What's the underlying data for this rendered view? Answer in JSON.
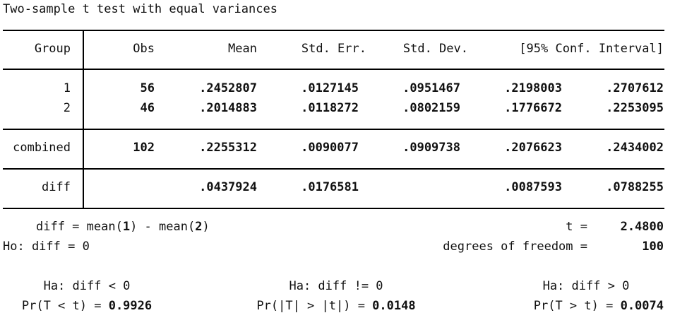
{
  "title": "Two-sample t test with equal variances",
  "headers": {
    "group": "Group",
    "obs": "Obs",
    "mean": "Mean",
    "std_err": "Std. Err.",
    "std_dev": "Std. Dev.",
    "ci": "[95% Conf. Interval]"
  },
  "rows": [
    {
      "group": "1",
      "obs": "56",
      "mean": ".2452807",
      "std_err": ".0127145",
      "std_dev": ".0951467",
      "ci_low": ".2198003",
      "ci_high": ".2707612"
    },
    {
      "group": "2",
      "obs": "46",
      "mean": ".2014883",
      "std_err": ".0118272",
      "std_dev": ".0802159",
      "ci_low": ".1776672",
      "ci_high": ".2253095"
    }
  ],
  "combined": {
    "group": "combined",
    "obs": "102",
    "mean": ".2255312",
    "std_err": ".0090077",
    "std_dev": ".0909738",
    "ci_low": ".2076623",
    "ci_high": ".2434002"
  },
  "diff": {
    "group": "diff",
    "mean": ".0437924",
    "std_err": ".0176581",
    "ci_low": ".0087593",
    "ci_high": ".0788255"
  },
  "footer": {
    "diff_def_a": "diff = mean(",
    "diff_def_g1": "1",
    "diff_def_b": ") - mean(",
    "diff_def_g2": "2",
    "diff_def_c": ")",
    "t_label": "t =",
    "t_value": "2.4800",
    "ho": "Ho: diff = 0",
    "df_label": "degrees of freedom =",
    "df_value": "100"
  },
  "alternatives": [
    {
      "ha": "Ha: diff < 0",
      "pr_label": "Pr(T < t) = ",
      "pr_value": "0.9926"
    },
    {
      "ha": "Ha: diff != 0",
      "pr_label": "Pr(|T| > |t|) = ",
      "pr_value": "0.0148"
    },
    {
      "ha": "Ha: diff > 0",
      "pr_label": "Pr(T > t) = ",
      "pr_value": "0.0074"
    }
  ]
}
